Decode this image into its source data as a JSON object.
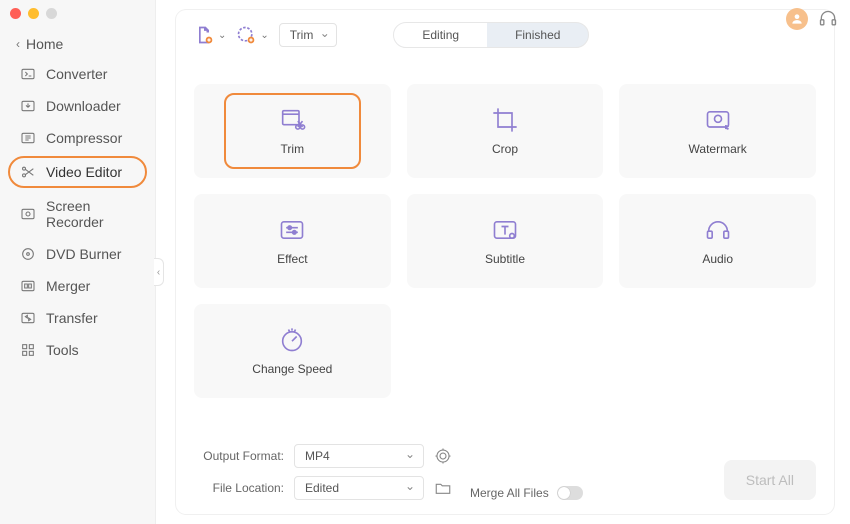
{
  "window": {
    "traffic": [
      "red",
      "yellow",
      "gray"
    ]
  },
  "topright": {
    "avatar": "user",
    "help": "headset"
  },
  "sidebar": {
    "home": "Home",
    "items": [
      {
        "label": "Converter",
        "icon": "convert"
      },
      {
        "label": "Downloader",
        "icon": "download"
      },
      {
        "label": "Compressor",
        "icon": "compress"
      },
      {
        "label": "Video Editor",
        "icon": "scissors",
        "active": true
      },
      {
        "label": "Screen Recorder",
        "icon": "record"
      },
      {
        "label": "DVD Burner",
        "icon": "disc"
      },
      {
        "label": "Merger",
        "icon": "merge"
      },
      {
        "label": "Transfer",
        "icon": "transfer"
      },
      {
        "label": "Tools",
        "icon": "tools"
      }
    ]
  },
  "toolbar": {
    "addfile_icon": "add-file",
    "addfolder_icon": "add-folder",
    "select_value": "Trim",
    "seg_editing": "Editing",
    "seg_finished": "Finished",
    "seg_active": "editing"
  },
  "tools": [
    {
      "label": "Trim",
      "icon": "trim",
      "selected": true
    },
    {
      "label": "Crop",
      "icon": "crop"
    },
    {
      "label": "Watermark",
      "icon": "watermark"
    },
    {
      "label": "Effect",
      "icon": "effect"
    },
    {
      "label": "Subtitle",
      "icon": "subtitle"
    },
    {
      "label": "Audio",
      "icon": "audio"
    },
    {
      "label": "Change Speed",
      "icon": "speed"
    }
  ],
  "bottom": {
    "output_format_label": "Output Format:",
    "output_format_value": "MP4",
    "file_location_label": "File Location:",
    "file_location_value": "Edited",
    "merge_label": "Merge All Files",
    "start_label": "Start  All",
    "settings_icon": "gear-target",
    "folder_icon": "folder"
  },
  "colors": {
    "accent": "#f08a3c",
    "icon_purple": "#8f7ed1"
  }
}
